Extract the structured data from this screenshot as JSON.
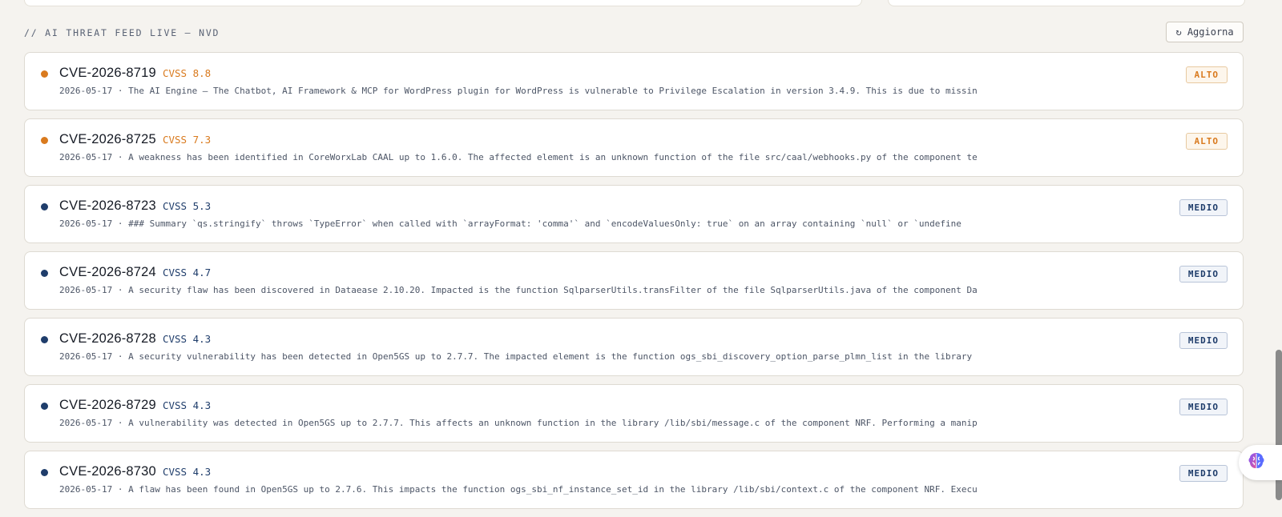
{
  "feed": {
    "title": "// AI THREAT FEED LIVE — NVD",
    "refresh": {
      "icon": "refresh-icon",
      "label": "↻ Aggiorna"
    },
    "colors": {
      "alto": "#d97a1e",
      "medio": "#1f3d6b"
    },
    "items": [
      {
        "id": "CVE-2026-8719",
        "score": "CVSS 8.8",
        "severity": "ALTO",
        "desc": "2026-05-17 · The AI Engine – The Chatbot, AI Framework & MCP for WordPress plugin for WordPress is vulnerable to Privilege Escalation in version 3.4.9. This is due to missin"
      },
      {
        "id": "CVE-2026-8725",
        "score": "CVSS 7.3",
        "severity": "ALTO",
        "desc": "2026-05-17 · A weakness has been identified in CoreWorxLab CAAL up to 1.6.0. The affected element is an unknown function of the file src/caal/webhooks.py of the component te"
      },
      {
        "id": "CVE-2026-8723",
        "score": "CVSS 5.3",
        "severity": "MEDIO",
        "desc": "2026-05-17 · ### Summary `qs.stringify` throws `TypeError` when called with `arrayFormat: 'comma'` and `encodeValuesOnly: true` on an array containing `null` or `undefine"
      },
      {
        "id": "CVE-2026-8724",
        "score": "CVSS 4.7",
        "severity": "MEDIO",
        "desc": "2026-05-17 · A security flaw has been discovered in Dataease 2.10.20. Impacted is the function SqlparserUtils.transFilter of the file SqlparserUtils.java of the component Da"
      },
      {
        "id": "CVE-2026-8728",
        "score": "CVSS 4.3",
        "severity": "MEDIO",
        "desc": "2026-05-17 · A security vulnerability has been detected in Open5GS up to 2.7.7. The impacted element is the function ogs_sbi_discovery_option_parse_plmn_list in the library"
      },
      {
        "id": "CVE-2026-8729",
        "score": "CVSS 4.3",
        "severity": "MEDIO",
        "desc": "2026-05-17 · A vulnerability was detected in Open5GS up to 2.7.7. This affects an unknown function in the library /lib/sbi/message.c of the component NRF. Performing a manip"
      },
      {
        "id": "CVE-2026-8730",
        "score": "CVSS 4.3",
        "severity": "MEDIO",
        "desc": "2026-05-17 · A flaw has been found in Open5GS up to 2.7.6. This impacts the function ogs_sbi_nf_instance_set_id in the library /lib/sbi/context.c of the component NRF. Execu"
      }
    ]
  },
  "assistant": {
    "icon": "brain-icon"
  }
}
